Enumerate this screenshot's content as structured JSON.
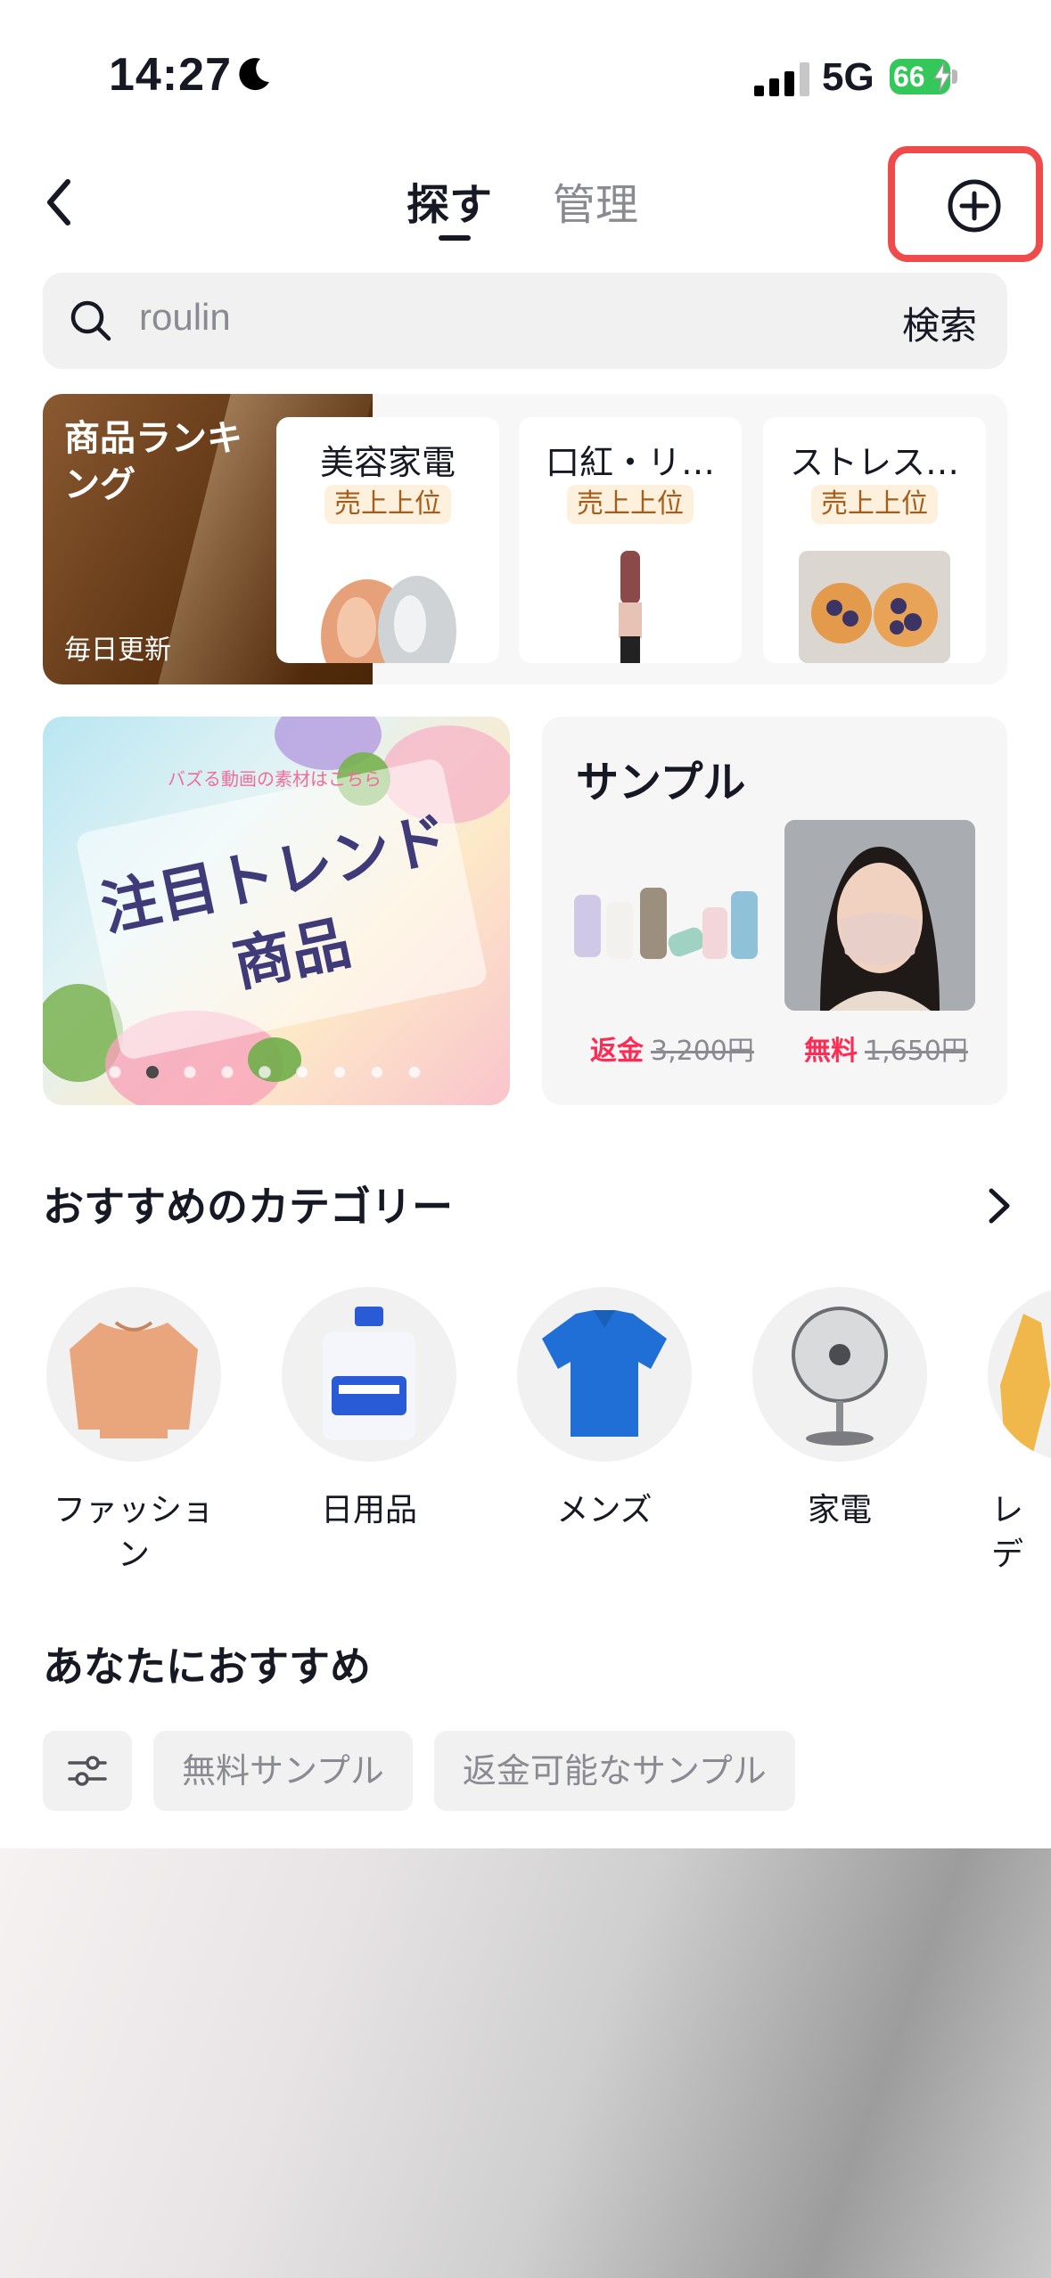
{
  "status_bar": {
    "time": "14:27",
    "network": "5G",
    "battery": "66"
  },
  "nav": {
    "tabs": [
      {
        "label": "探す",
        "active": true
      },
      {
        "label": "管理",
        "active": false
      }
    ],
    "back_icon": "chevron-left-icon",
    "add_icon": "plus-circle-icon",
    "highlight_color": "#f04b4b"
  },
  "search": {
    "value": "roulin",
    "button_label": "検索"
  },
  "ranking": {
    "title": "商品ランキング",
    "subtitle": "毎日更新",
    "cards": [
      {
        "title": "美容家電",
        "badge": "売上上位"
      },
      {
        "title": "口紅・リ…",
        "badge": "売上上位"
      },
      {
        "title": "ストレス…",
        "badge": "売上上位"
      }
    ]
  },
  "banner": {
    "small_text": "バズる動画の素材はこちら",
    "title": "注目トレンド\n商品",
    "page_count": 9,
    "active_page": 2
  },
  "sample": {
    "title": "サンプル",
    "items": [
      {
        "tag": "返金",
        "old_price": "3,200円"
      },
      {
        "tag": "無料",
        "old_price": "1,650円"
      }
    ]
  },
  "categories": {
    "title": "おすすめのカテゴリー",
    "items": [
      {
        "label": "ファッション"
      },
      {
        "label": "日用品"
      },
      {
        "label": "メンズ"
      },
      {
        "label": "家電"
      },
      {
        "label": "レデ"
      }
    ]
  },
  "recommend": {
    "title": "あなたにおすすめ",
    "filter_icon": "sliders-icon",
    "chips": [
      "無料サンプル",
      "返金可能なサンプル"
    ]
  },
  "colors": {
    "accent_red": "#fe2c55",
    "badge_bg": "#fdf0dc",
    "badge_text": "#a45d1a"
  }
}
